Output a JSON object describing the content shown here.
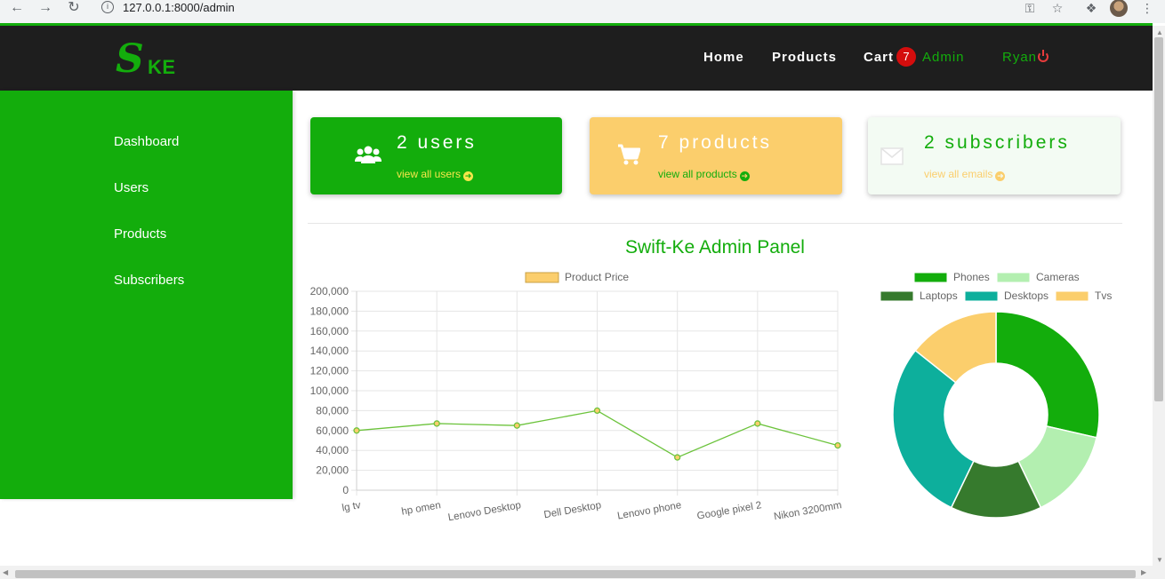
{
  "browser": {
    "url": "127.0.0.1:8000/admin"
  },
  "navbar": {
    "logo_s": "S",
    "logo_ke": "KE",
    "links": [
      "Home",
      "Products",
      "Cart"
    ],
    "cart_count": "7",
    "admin_label": "Admin",
    "user_name": "Ryan"
  },
  "sidebar": {
    "items": [
      {
        "label": "Dashboard"
      },
      {
        "label": "Users"
      },
      {
        "label": "Products"
      },
      {
        "label": "Subscribers"
      }
    ]
  },
  "cards": [
    {
      "title": "2 users",
      "link": "view all users",
      "icon": "users-icon"
    },
    {
      "title": "7 products",
      "link": "view all products",
      "icon": "cart-icon"
    },
    {
      "title": "2 subscribers",
      "link": "view all emails",
      "icon": "envelope-icon"
    }
  ],
  "panel_title": "Swift-Ke Admin Panel",
  "colors": {
    "brand_green": "#13ad0c",
    "navbar_dark": "#1e1e1e",
    "card_yellow": "#fbce6c",
    "card_light": "#f3fbf3",
    "badge_red": "#d40d0d"
  },
  "chart_data": [
    {
      "type": "line",
      "legend": [
        "Product Price"
      ],
      "categories": [
        "lg tv",
        "hp omen",
        "Lenovo Desktop",
        "Dell Desktop",
        "Lenovo phone",
        "Google pixel 2",
        "Nikon 3200mm"
      ],
      "series": [
        {
          "name": "Product Price",
          "values": [
            60000,
            67000,
            65000,
            80000,
            33000,
            67000,
            45000
          ]
        }
      ],
      "ylim": [
        0,
        200000
      ],
      "yticks": [
        "0",
        "20,000",
        "40,000",
        "60,000",
        "80,000",
        "100,000",
        "120,000",
        "140,000",
        "160,000",
        "180,000",
        "200,000"
      ],
      "grid": true,
      "legend_position": "top",
      "line_color": "#6cc33c"
    },
    {
      "type": "pie",
      "legend": [
        "Phones",
        "Cameras",
        "Laptops",
        "Desktops",
        "Tvs"
      ],
      "values": [
        2,
        1,
        1,
        2,
        1
      ],
      "colors": [
        "#13ad0c",
        "#b3efb0",
        "#367a2d",
        "#0daf9c",
        "#fbce6c"
      ],
      "legend_position": "top"
    }
  ]
}
